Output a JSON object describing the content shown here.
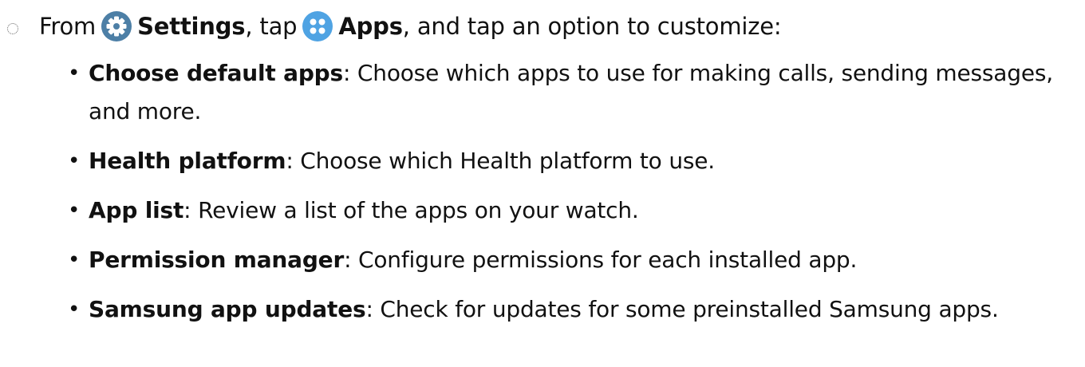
{
  "intro": {
    "from": "From",
    "settings_label": "Settings",
    "tap": ", tap",
    "apps_label": "Apps",
    "rest": ", and tap an option to customize:"
  },
  "icons": {
    "step": "dotted-circle-icon",
    "settings": "gear-icon",
    "apps": "apps-grid-icon"
  },
  "colors": {
    "settings_icon_bg": "#4d7fa6",
    "apps_icon_bg": "#4fa3e3"
  },
  "options": [
    {
      "term": "Choose default apps",
      "description": ": Choose which apps to use for making calls, sending messages, and more."
    },
    {
      "term": "Health platform",
      "description": ": Choose which Health platform to use."
    },
    {
      "term": "App list",
      "description": ": Review a list of the apps on your watch."
    },
    {
      "term": "Permission manager",
      "description": ": Configure permissions for each installed app."
    },
    {
      "term": "Samsung app updates",
      "description": ": Check for updates for some preinstalled Samsung apps."
    }
  ]
}
